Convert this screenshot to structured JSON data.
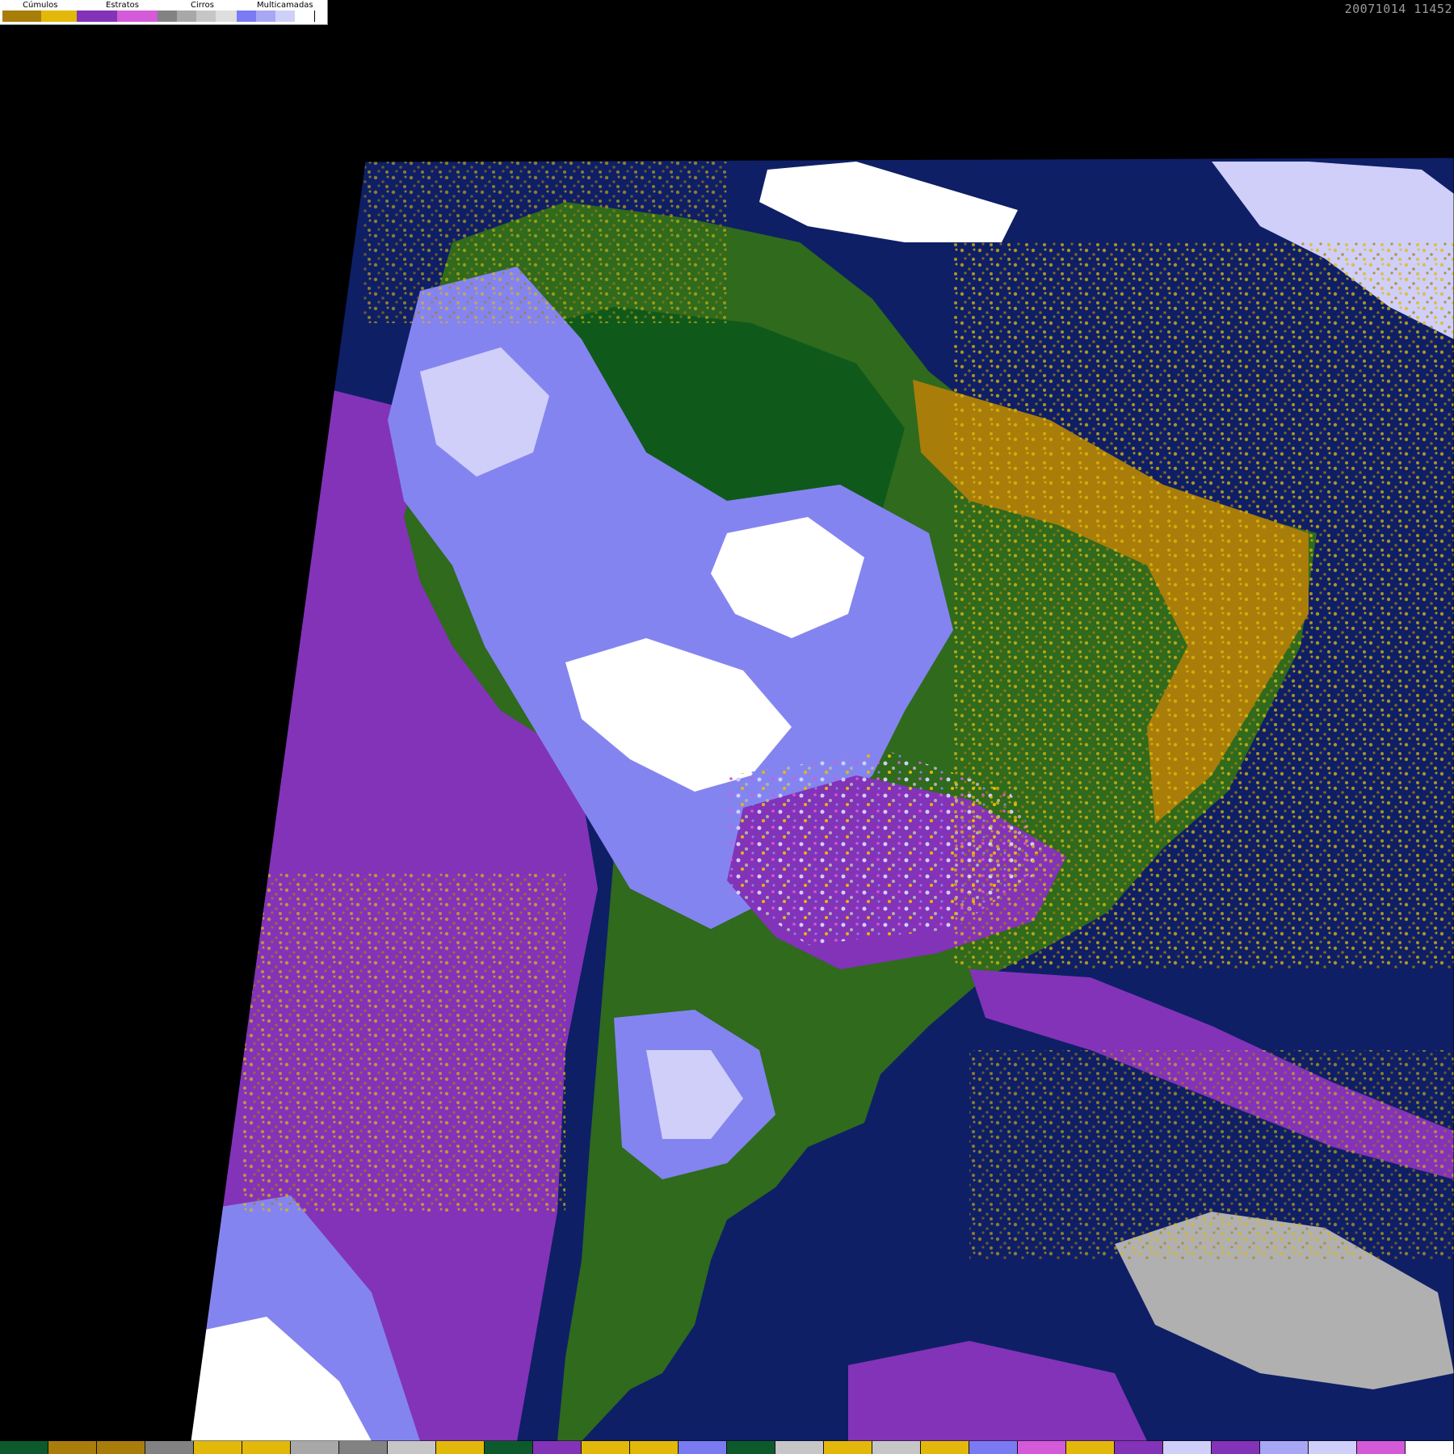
{
  "legend": {
    "groups": [
      {
        "label": "Cúmulos",
        "colors": [
          "#a87d0a",
          "#e2b90a"
        ]
      },
      {
        "label": "Estratos",
        "colors": [
          "#8333b8",
          "#d35ad8"
        ]
      },
      {
        "label": "Cirros",
        "colors": [
          "#828282",
          "#a8a8a8",
          "#c6c6c6",
          "#dedede"
        ]
      },
      {
        "label": "Multicamadas",
        "colors": [
          "#7a7af2",
          "#a7a7f5",
          "#cfcff9",
          "#ffffff"
        ]
      }
    ]
  },
  "timestamp": "20071014 11452",
  "map_colors": {
    "ocean": "#0e1f66",
    "land": "#2f6a1d",
    "forest": "#0f5a1b",
    "stratus": "#8333b8",
    "stratus_light": "#c45bd0",
    "cumulus": "#e2b90a",
    "cumulus_dark": "#a87d0a",
    "cirrus": "#b0b0b0",
    "multilayer": "#8484f0",
    "multilayer_light": "#cfcff9",
    "white": "#ffffff"
  },
  "bottom_bar": [
    "#0c5a2b",
    "#a87d0a",
    "#a87d0a",
    "#828282",
    "#e2b90a",
    "#e2b90a",
    "#a8a8a8",
    "#828282",
    "#c6c6c6",
    "#e2b90a",
    "#0c5a2b",
    "#8333b8",
    "#e2b90a",
    "#e2b90a",
    "#7a7af2",
    "#0c5a2b",
    "#c6c6c6",
    "#e2b90a",
    "#c6c6c6",
    "#e2b90a",
    "#7a7af2",
    "#d35ad8",
    "#e2b90a",
    "#8333b8",
    "#cfcff9",
    "#8333b8",
    "#a7a7f5",
    "#cfcff9",
    "#d35ad8",
    "#ffffff"
  ]
}
